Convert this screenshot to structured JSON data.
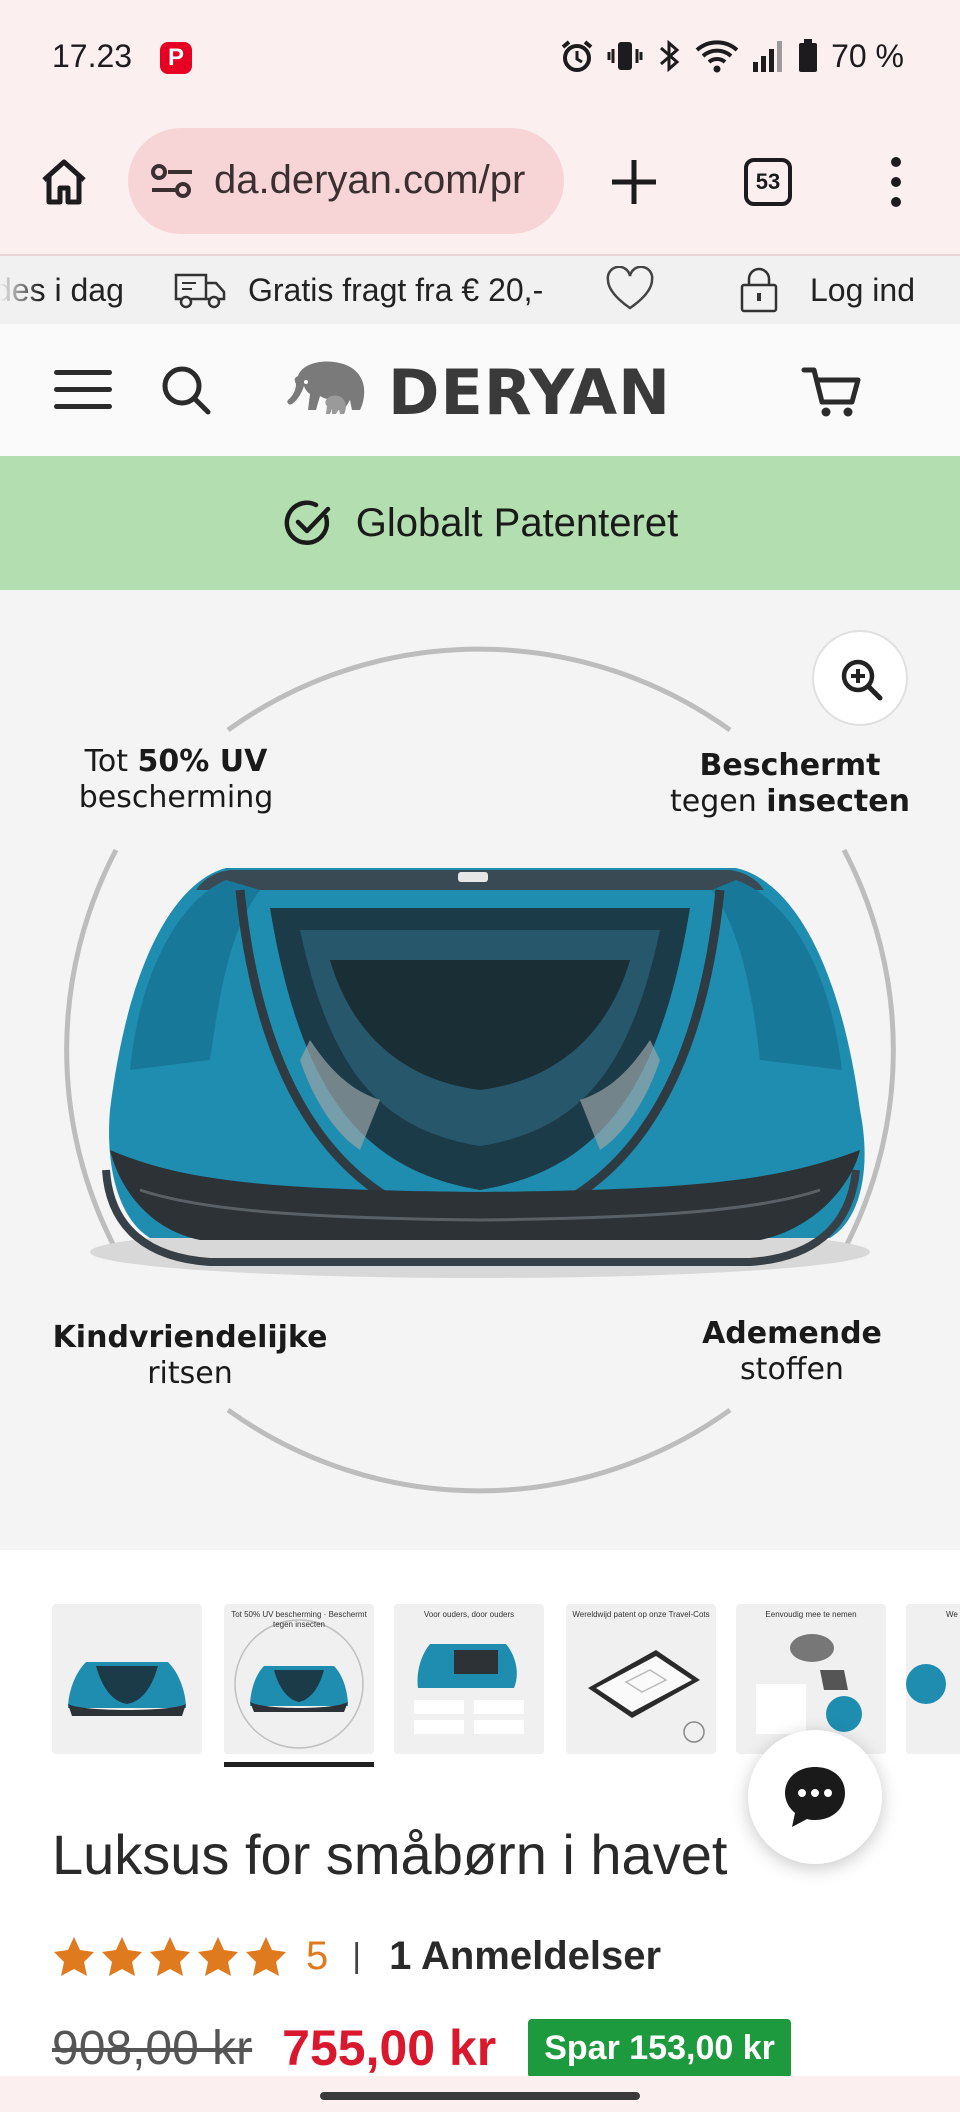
{
  "status_bar": {
    "time": "17.23",
    "app_badge": "P",
    "battery_text": "70 %"
  },
  "browser": {
    "url": "da.deryan.com/pr",
    "tab_count": "53"
  },
  "promo": {
    "left_text": "des i dag",
    "shipping": "Gratis fragt fra € 20,-",
    "login": "Log ind"
  },
  "header": {
    "logo_text": "DERYAN"
  },
  "banner": {
    "text": "Globalt Patenteret"
  },
  "hero": {
    "features": {
      "uv_prefix": "Tot ",
      "uv_bold": "50% UV",
      "uv_line2": "bescherming",
      "insect_line1": "Beschermt",
      "insect_line2_prefix": "tegen ",
      "insect_line2_bold": "insecten",
      "zip_line1": "Kindvriendelijke",
      "zip_line2": "ritsen",
      "fabric_line1": "Ademende",
      "fabric_line2": "stoffen"
    }
  },
  "thumbnails": {
    "items": [
      {
        "caption": ""
      },
      {
        "caption": "Tot 50% UV bescherming · Beschermt tegen insecten"
      },
      {
        "caption": "Voor ouders, door ouders"
      },
      {
        "caption": "Wereldwijd patent op onze Travel-Cots"
      },
      {
        "caption": "Eenvoudig mee te nemen"
      },
      {
        "caption": "We"
      }
    ],
    "active_index": 1
  },
  "product": {
    "title": "Luksus for småbørn i havet",
    "rating": 5,
    "rating_label": "5",
    "rating_separator": "|",
    "reviews": "1 Anmeldelser",
    "old_price": "908,00 kr",
    "new_price": "755,00 kr",
    "save_badge": "Spar 153,00 kr"
  },
  "colors": {
    "banner_bg": "#b3deb0",
    "price_red": "#d9182d",
    "save_green": "#1e9a3e",
    "star_orange": "#e07a1f",
    "tent_teal": "#1e8fb0"
  }
}
